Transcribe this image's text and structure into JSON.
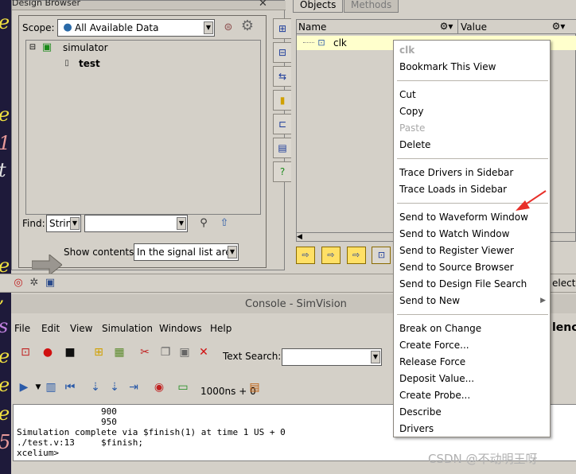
{
  "design_browser": {
    "title": "Design Browser",
    "scope_label": "Scope:",
    "scope_value": "All Available Data",
    "tree": [
      {
        "label": "simulator"
      },
      {
        "label": "test"
      }
    ],
    "find_label": "Find:",
    "find_type": "String",
    "find_value": "",
    "show_contents_label": "Show contents:",
    "show_contents_value": "In the signal list area"
  },
  "objects": {
    "tabs": [
      "Objects",
      "Methods"
    ],
    "columns": [
      "Name",
      "Value"
    ],
    "rows": [
      {
        "name": "clk"
      }
    ]
  },
  "context_menu": {
    "header": "clk",
    "groups": [
      [
        {
          "label": "Bookmark This View"
        }
      ],
      [
        {
          "label": "Cut"
        },
        {
          "label": "Copy"
        },
        {
          "label": "Paste",
          "disabled": true
        },
        {
          "label": "Delete"
        }
      ],
      [
        {
          "label": "Trace Drivers in Sidebar"
        },
        {
          "label": "Trace Loads in Sidebar"
        }
      ],
      [
        {
          "label": "Send to Waveform Window"
        },
        {
          "label": "Send to Watch Window"
        },
        {
          "label": "Send to Register Viewer"
        },
        {
          "label": "Send to Source Browser"
        },
        {
          "label": "Send to Design File Search"
        },
        {
          "label": "Send to New",
          "submenu": true
        }
      ],
      [
        {
          "label": "Break on Change"
        },
        {
          "label": "Create Force..."
        },
        {
          "label": "Release Force"
        },
        {
          "label": "Deposit Value..."
        },
        {
          "label": "Create Probe..."
        },
        {
          "label": "Describe"
        },
        {
          "label": "Drivers"
        }
      ]
    ]
  },
  "console": {
    "title": "Console - SimVision",
    "menu": [
      "File",
      "Edit",
      "View",
      "Simulation",
      "Windows",
      "Help"
    ],
    "text_search_label": "Text Search:",
    "text_search_value": "",
    "time_value": "1000ns + 0",
    "output": [
      "                900",
      "                950",
      "Simulation complete via $finish(1) at time 1 US + 0",
      "./test.v:13     $finish;",
      "xcelium>"
    ]
  },
  "partial_text": {
    "right_header": "lenc",
    "right_bottom": "electe"
  },
  "watermark": "CSDN @不动明王呀",
  "colors": {
    "window_bg": "#d4d0c8",
    "row_highlight": "#ffffcc",
    "editor_bg": "#1e1a3a",
    "arrow_red": "#e8302a",
    "menu_bg": "#ffffff"
  }
}
